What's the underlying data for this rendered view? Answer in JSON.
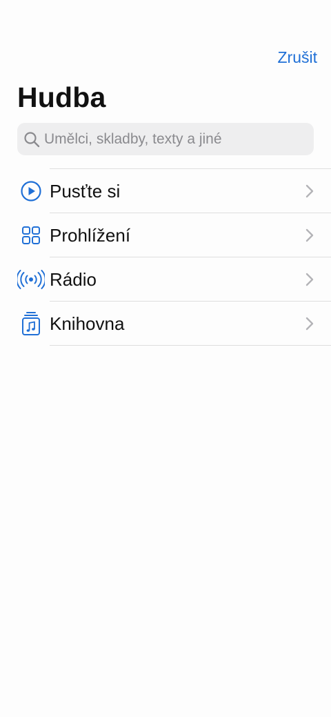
{
  "header": {
    "cancel_label": "Zrušit",
    "title": "Hudba"
  },
  "search": {
    "placeholder": "Umělci, skladby, texty a jiné",
    "icon": "search-icon"
  },
  "menu": {
    "items": [
      {
        "label": "Pusťte si",
        "icon": "play-circle-icon"
      },
      {
        "label": "Prohlížení",
        "icon": "grid-icon"
      },
      {
        "label": "Rádio",
        "icon": "radio-broadcast-icon"
      },
      {
        "label": "Knihovna",
        "icon": "music-library-icon"
      }
    ]
  },
  "colors": {
    "accent": "#1f6fd6",
    "background": "#fdfdfd",
    "search_bg": "#eeeeef",
    "separator": "#dedede",
    "chevron": "#b3b3b7"
  }
}
